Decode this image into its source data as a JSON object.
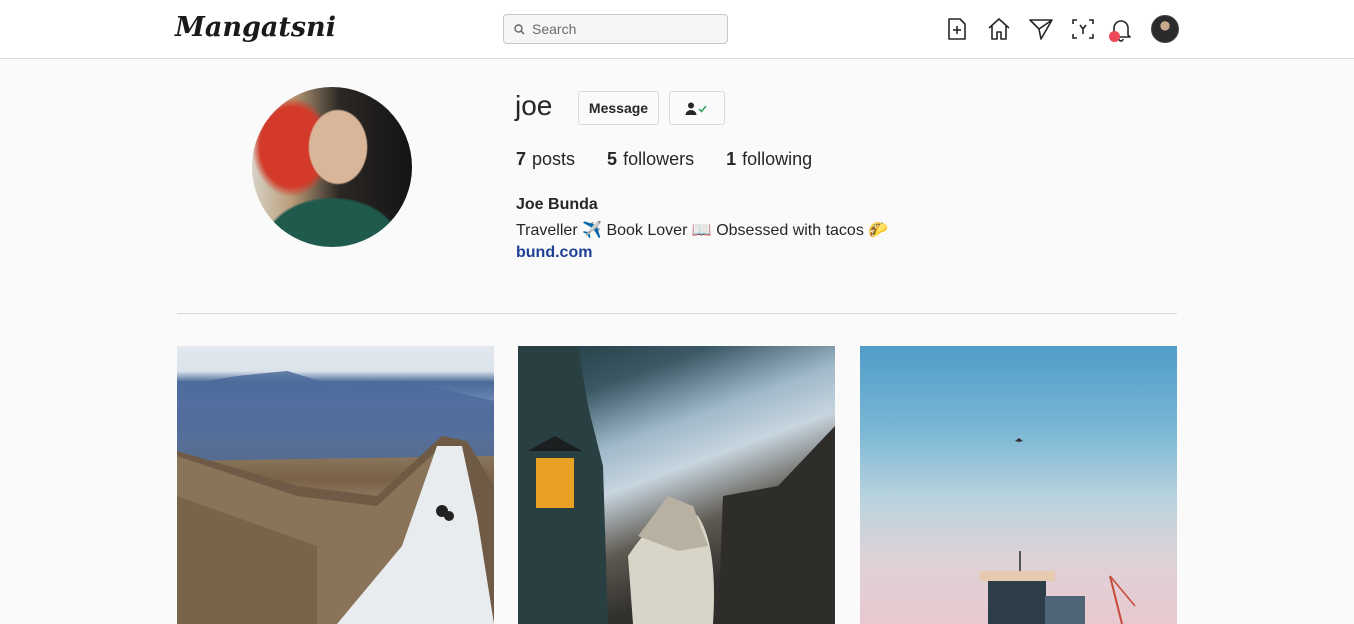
{
  "app": {
    "logo": "Mangatsni"
  },
  "search": {
    "placeholder": "Search"
  },
  "nav": {
    "icons": [
      "add-post-icon",
      "home-icon",
      "send-icon",
      "explore-icon",
      "bell-icon"
    ],
    "notification_dot_color": "#ed4956"
  },
  "profile": {
    "username": "joe",
    "message_label": "Message",
    "stats": {
      "posts_count": "7",
      "posts_label": "posts",
      "followers_count": "5",
      "followers_label": "followers",
      "following_count": "1",
      "following_label": "following"
    },
    "full_name": "Joe Bunda",
    "bio": "Traveller ✈️ Book Lover 📖 Obsessed with tacos 🌮",
    "website": "bund.com"
  },
  "colors": {
    "link": "#1d3f94",
    "border": "#dbdbdb",
    "background": "#fafafa"
  }
}
